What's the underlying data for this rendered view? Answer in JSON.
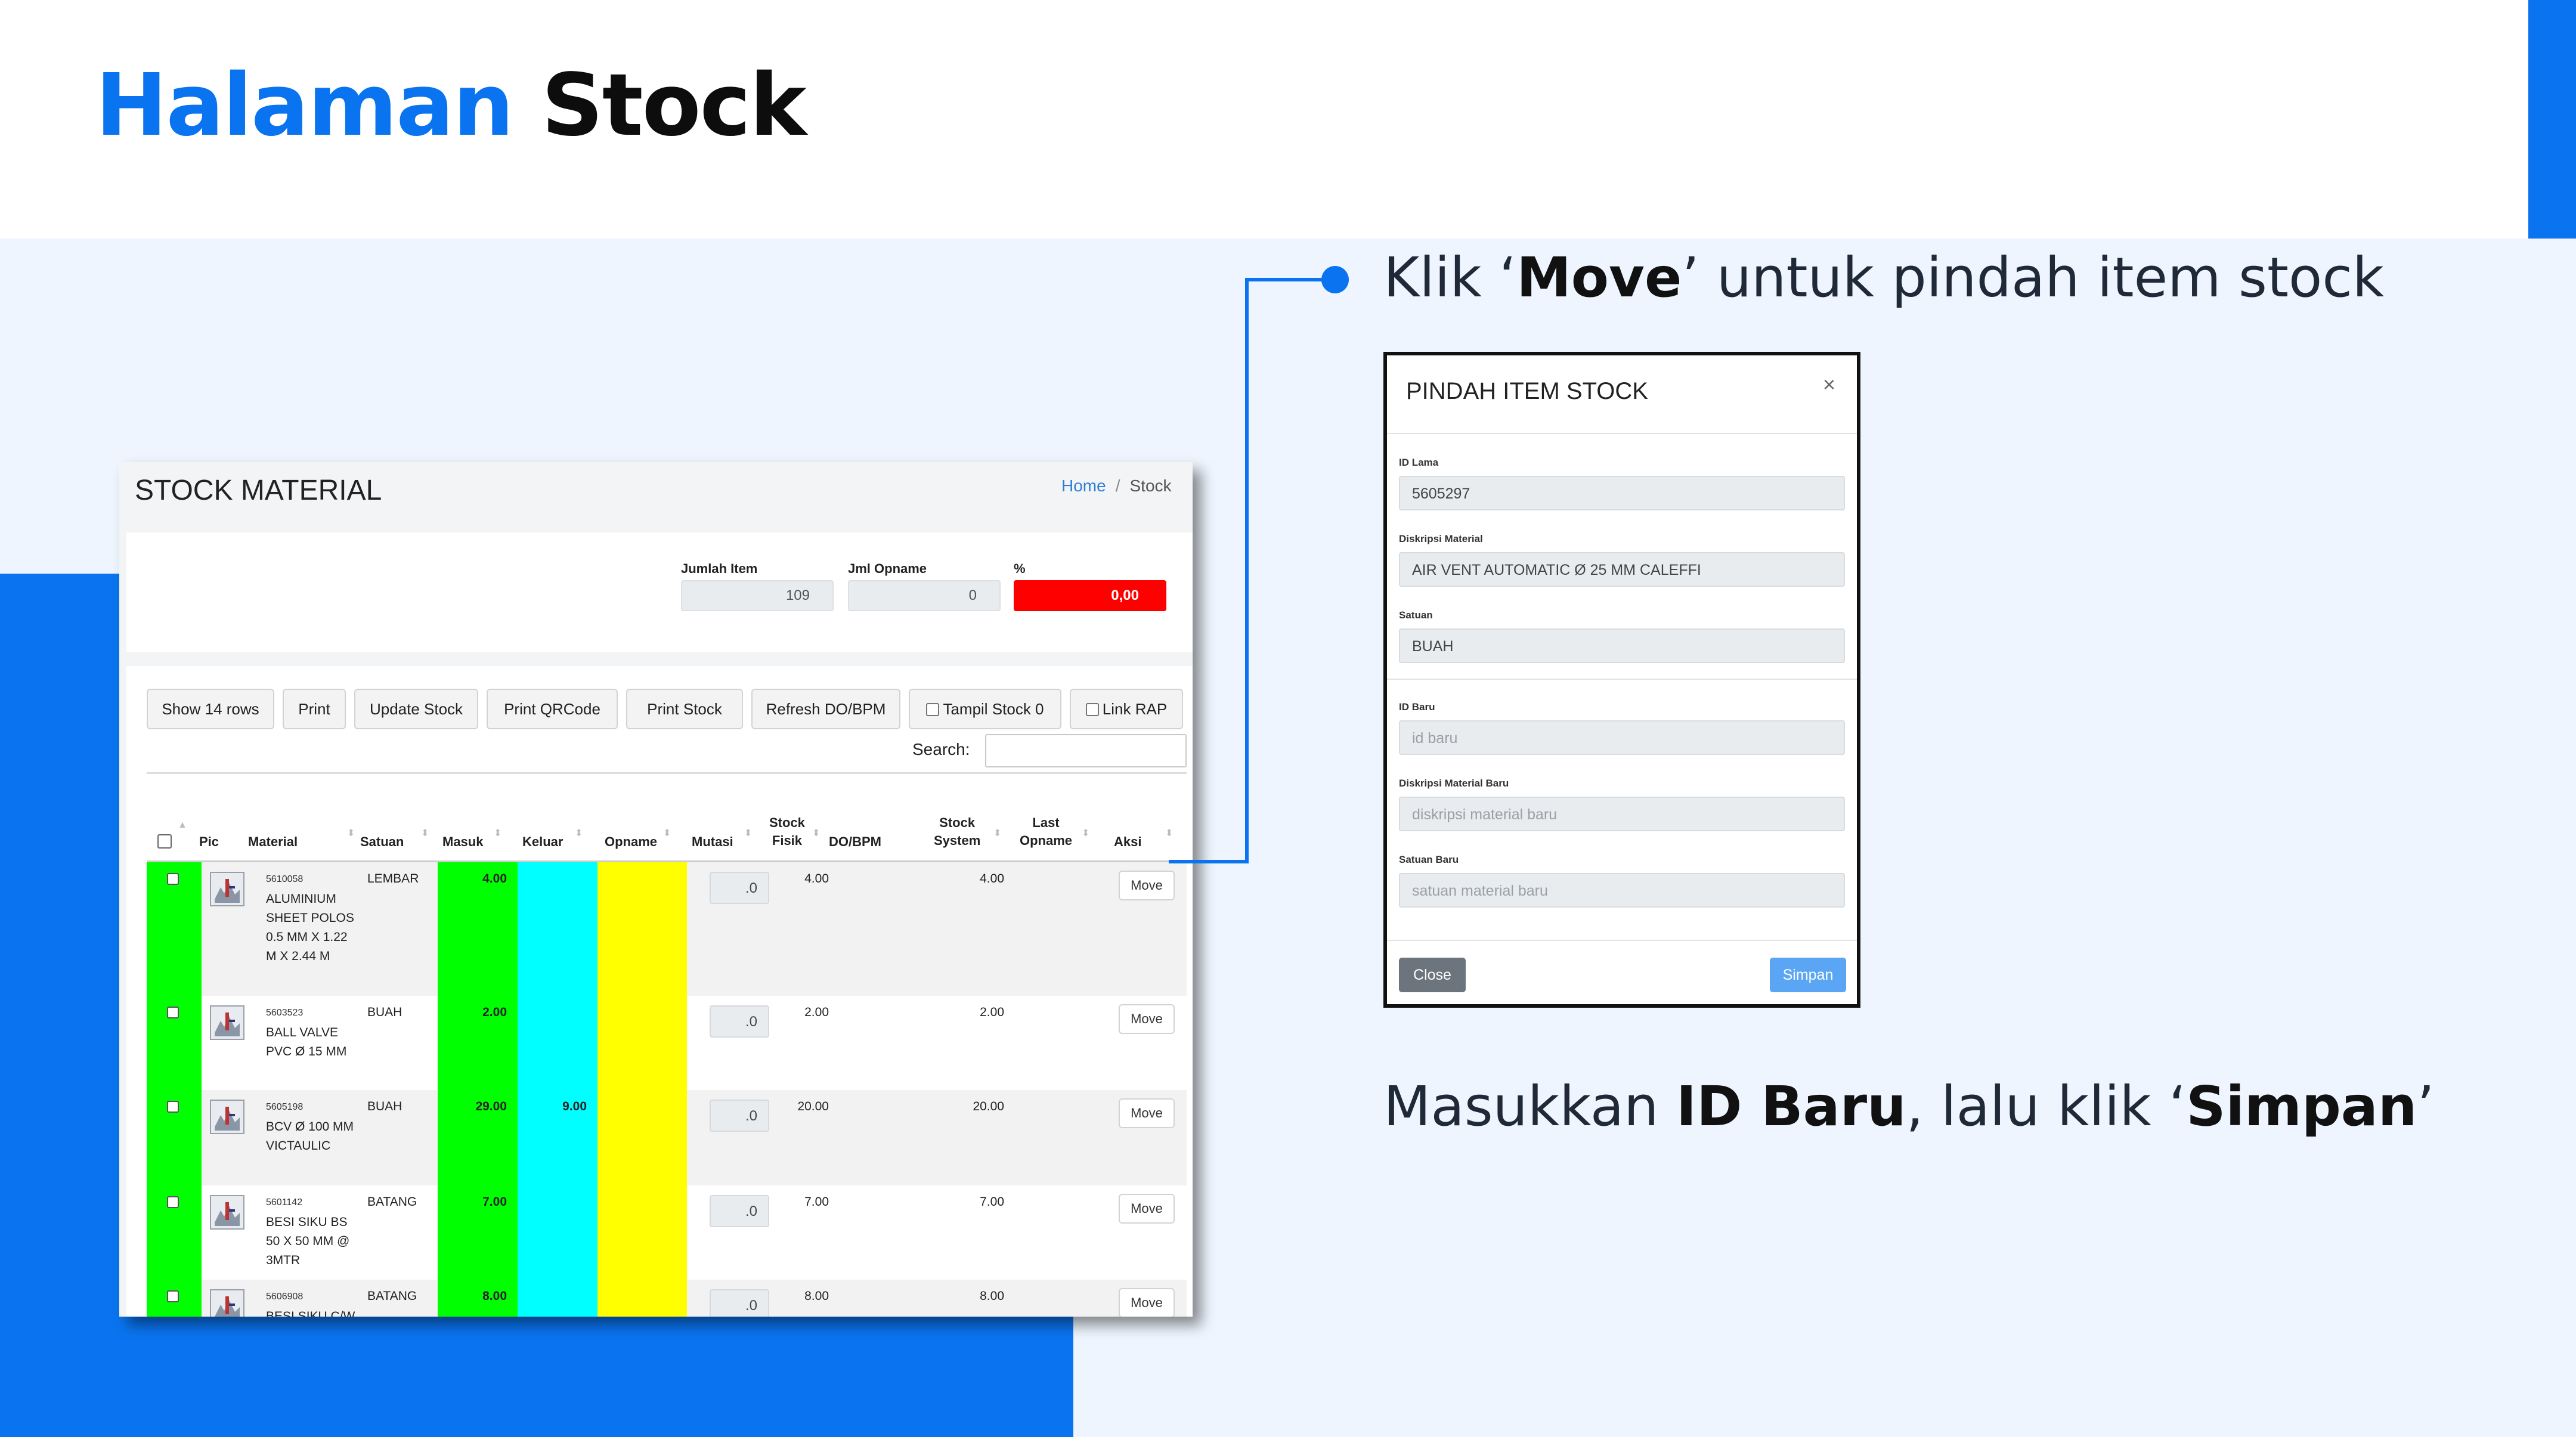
{
  "slide": {
    "title_part1": "Halaman",
    "title_part2": "Stock",
    "callout_top": {
      "pre": "Klik ‘",
      "bold": "Move",
      "post": "’ untuk pindah item stock"
    },
    "callout_bottom": {
      "pre": "Masukkan ",
      "bold1": "ID Baru",
      "mid": ", lalu klik ‘",
      "bold2": "Simpan",
      "post": "’"
    },
    "accent_color": "#0a74f0"
  },
  "page": {
    "title": "STOCK MATERIAL",
    "breadcrumb": {
      "home": "Home",
      "separator": "/",
      "current": "Stock"
    }
  },
  "summary": {
    "jumlah_item": {
      "label": "Jumlah Item",
      "value": "109"
    },
    "jml_opname": {
      "label": "Jml Opname",
      "value": "0"
    },
    "percent": {
      "label": "%",
      "value": "0,00"
    }
  },
  "toolbar": {
    "show_rows": "Show 14 rows",
    "print": "Print",
    "update_stock": "Update Stock",
    "print_qrcode": "Print QRCode",
    "print_stock": "Print Stock",
    "refresh": "Refresh DO/BPM",
    "tampil_stock": "Tampil Stock 0",
    "link_rap": "Link RAP",
    "search_label": "Search:"
  },
  "table": {
    "headers": {
      "pic": "Pic",
      "material": "Material",
      "satuan": "Satuan",
      "masuk": "Masuk",
      "keluar": "Keluar",
      "opname": "Opname",
      "mutasi": "Mutasi",
      "stock_fisik_1": "Stock",
      "stock_fisik_2": "Fisik",
      "do_bpm": "DO/BPM",
      "stock_system_1": "Stock",
      "stock_system_2": "System",
      "last_opname_1": "Last",
      "last_opname_2": "Opname",
      "aksi": "Aksi"
    },
    "rows": [
      {
        "code": "5610058",
        "name": "ALUMINIUM SHEET POLOS 0.5 MM X 1.22 M X 2.44 M",
        "satuan": "LEMBAR",
        "masuk": "4.00",
        "keluar": "",
        "mutasi": ".0",
        "stock_fisik": "4.00",
        "stock_system": "4.00",
        "action": "Move"
      },
      {
        "code": "5603523",
        "name": "BALL VALVE PVC Ø 15 MM",
        "satuan": "BUAH",
        "masuk": "2.00",
        "keluar": "",
        "mutasi": ".0",
        "stock_fisik": "2.00",
        "stock_system": "2.00",
        "action": "Move"
      },
      {
        "code": "5605198",
        "name": "BCV Ø 100 MM VICTAULIC",
        "satuan": "BUAH",
        "masuk": "29.00",
        "keluar": "9.00",
        "mutasi": ".0",
        "stock_fisik": "20.00",
        "stock_system": "20.00",
        "action": "Move"
      },
      {
        "code": "5601142",
        "name": "BESI SIKU BS 50 X 50 MM @ 3MTR",
        "satuan": "BATANG",
        "masuk": "7.00",
        "keluar": "",
        "mutasi": ".0",
        "stock_fisik": "7.00",
        "stock_system": "7.00",
        "action": "Move"
      },
      {
        "code": "5606908",
        "name": "BESI SIKU C/W",
        "satuan": "BATANG",
        "masuk": "8.00",
        "keluar": "",
        "mutasi": ".0",
        "stock_fisik": "8.00",
        "stock_system": "8.00",
        "action": "Move"
      }
    ],
    "colors": {
      "masuk": "#00ff00",
      "keluar": "#00ffff",
      "opname": "#ffff00",
      "checkbox_col": "#00ff00"
    }
  },
  "modal": {
    "title": "PINDAH ITEM STOCK",
    "close_x": "×",
    "id_lama": {
      "label": "ID Lama",
      "value": "5605297"
    },
    "diskripsi": {
      "label": "Diskripsi Material",
      "value": "AIR VENT AUTOMATIC Ø 25 MM CALEFFI"
    },
    "satuan": {
      "label": "Satuan",
      "value": "BUAH"
    },
    "id_baru": {
      "label": "ID Baru",
      "placeholder": "id baru"
    },
    "diskripsi_baru": {
      "label": "Diskripsi Material Baru",
      "placeholder": "diskripsi material baru"
    },
    "satuan_baru": {
      "label": "Satuan Baru",
      "placeholder": "satuan material baru"
    },
    "close_button": "Close",
    "save_button": "Simpan"
  }
}
